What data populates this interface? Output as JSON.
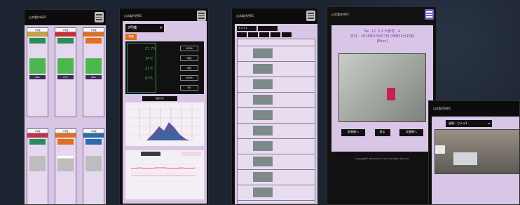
{
  "phone1": {
    "unit_badges": [
      "1号機",
      "2号機",
      "3号機",
      "4号機",
      "5号機",
      "6号機"
    ],
    "row1": [
      {
        "name_color": "#c8a040",
        "status_color": "#2a8c5a",
        "fill": 1.0,
        "pct": "89%"
      },
      {
        "name_color": "#c83030",
        "status_color": "#2a8c5a",
        "fill": 1.0,
        "pct": "97%"
      },
      {
        "name_color": "#e07020",
        "status_color": "#e07020",
        "fill": 1.0,
        "pct": "88%"
      }
    ],
    "row2": [
      {
        "name_color": "#c03050",
        "status_color": "#2a8c5a",
        "fill": 0.0
      },
      {
        "name_color": "#e07020",
        "status_color": "#e07020",
        "fill": 0.15
      },
      {
        "name_color": "#2a6ca8",
        "status_color": "#2a6ca8",
        "fill": 0.0
      }
    ]
  },
  "phone2": {
    "dropdown": "3号機",
    "tab": "稼働",
    "readings": [
      [
        "57.7%",
        "100%"
      ],
      [
        "34℃",
        "中位"
      ],
      [
        "21℃",
        "中位"
      ],
      [
        "87%",
        "100%"
      ],
      [
        "",
        "OK"
      ]
    ],
    "section_label": "温度分布"
  },
  "phone3": {
    "camera_select": "カメラ1",
    "rows": [
      1,
      2,
      3,
      4,
      5,
      6,
      7,
      8,
      9,
      10
    ]
  },
  "phone4": {
    "title_line1": "No. 12 カメラ番号：4",
    "title_line2": "日付：2019年10月07日 09時32分15秒",
    "title_line3": "[8sec]",
    "btn_prev": "前画像へ",
    "btn_back": "戻る",
    "btn_next": "次画像へ",
    "copyright": "Copyright© Yamamoto Co.,Ltd. All rights reserved."
  },
  "phone5": {
    "camera_label": "画像：カメラ1"
  },
  "colors": {
    "accent": "#8855aa",
    "lavender": "#d9c5e5",
    "green": "#4db64f"
  }
}
